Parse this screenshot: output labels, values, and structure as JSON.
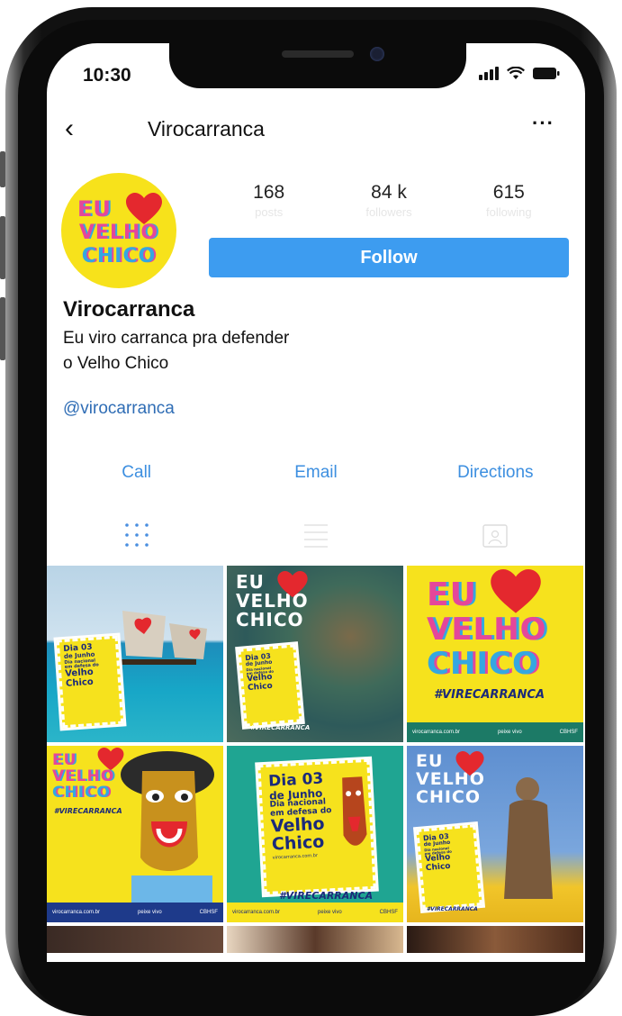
{
  "status_bar": {
    "time": "10:30"
  },
  "nav": {
    "title": "Virocarranca",
    "back_glyph": "‹",
    "more_glyph": "···"
  },
  "profile": {
    "logo_lines": [
      "EU",
      "VELHO",
      "CHICO"
    ],
    "stats": [
      {
        "value": "168",
        "label": "posts"
      },
      {
        "value": "84 k",
        "label": "followers"
      },
      {
        "value": "615",
        "label": "following"
      }
    ],
    "follow_label": "Follow",
    "name": "Virocarranca",
    "bio_line1": "Eu viro carranca pra defender",
    "bio_line2": "o Velho Chico",
    "handle": "@virocarranca"
  },
  "actions": {
    "call": "Call",
    "email": "Email",
    "directions": "Directions"
  },
  "view_tabs": [
    "grid-icon",
    "list-icon",
    "tagged-icon"
  ],
  "posts": {
    "p1": {
      "stamp": [
        "Dia 03",
        "de Junho",
        "Dia nacional",
        "em defesa do",
        "Velho",
        "Chico"
      ]
    },
    "p2": {
      "logo": [
        "EU",
        "VELHO",
        "CHICO"
      ],
      "stamp": [
        "Dia 03",
        "de Junho",
        "Dia nacional",
        "em defesa do",
        "Velho",
        "Chico"
      ],
      "tag": "#VIRECARRANCA"
    },
    "p3": {
      "logo": [
        "EU",
        "VELHO",
        "CHICO"
      ],
      "tag": "#VIRECARRANCA",
      "footer_left": "virocarranca.com.br",
      "footer_mid": "peixe vivo",
      "footer_right": "CBHSF"
    },
    "p4": {
      "logo": [
        "EU",
        "VELHO",
        "CHICO"
      ],
      "tag": "#VIRECARRANCA",
      "footer_left": "virocarranca.com.br",
      "footer_mid": "peixe vivo",
      "footer_right": "CBHSF"
    },
    "p5": {
      "stamp": [
        "Dia 03",
        "de Junho",
        "Dia nacional",
        "em defesa do",
        "Velho",
        "Chico"
      ],
      "site": "virocarranca.com.br",
      "tag": "#VIRECARRANCA",
      "footer_left": "virocarranca.com.br",
      "footer_mid": "peixe vivo",
      "footer_right": "CBHSF"
    },
    "p6": {
      "logo": [
        "EU",
        "VELHO",
        "CHICO"
      ],
      "stamp": [
        "Dia 03",
        "de Junho",
        "Dia nacional",
        "em defesa do",
        "Velho",
        "Chico"
      ],
      "tag": "#VIRECARRANCA"
    }
  },
  "colors": {
    "follow_bg": "#3d9cf0",
    "link": "#2f6db5",
    "action_blue": "#3d8fe0",
    "brand_yellow": "#f6e21d",
    "brand_blue": "#1b2a7a",
    "brand_red": "#e4282e",
    "brand_teal": "#1c7a66"
  }
}
